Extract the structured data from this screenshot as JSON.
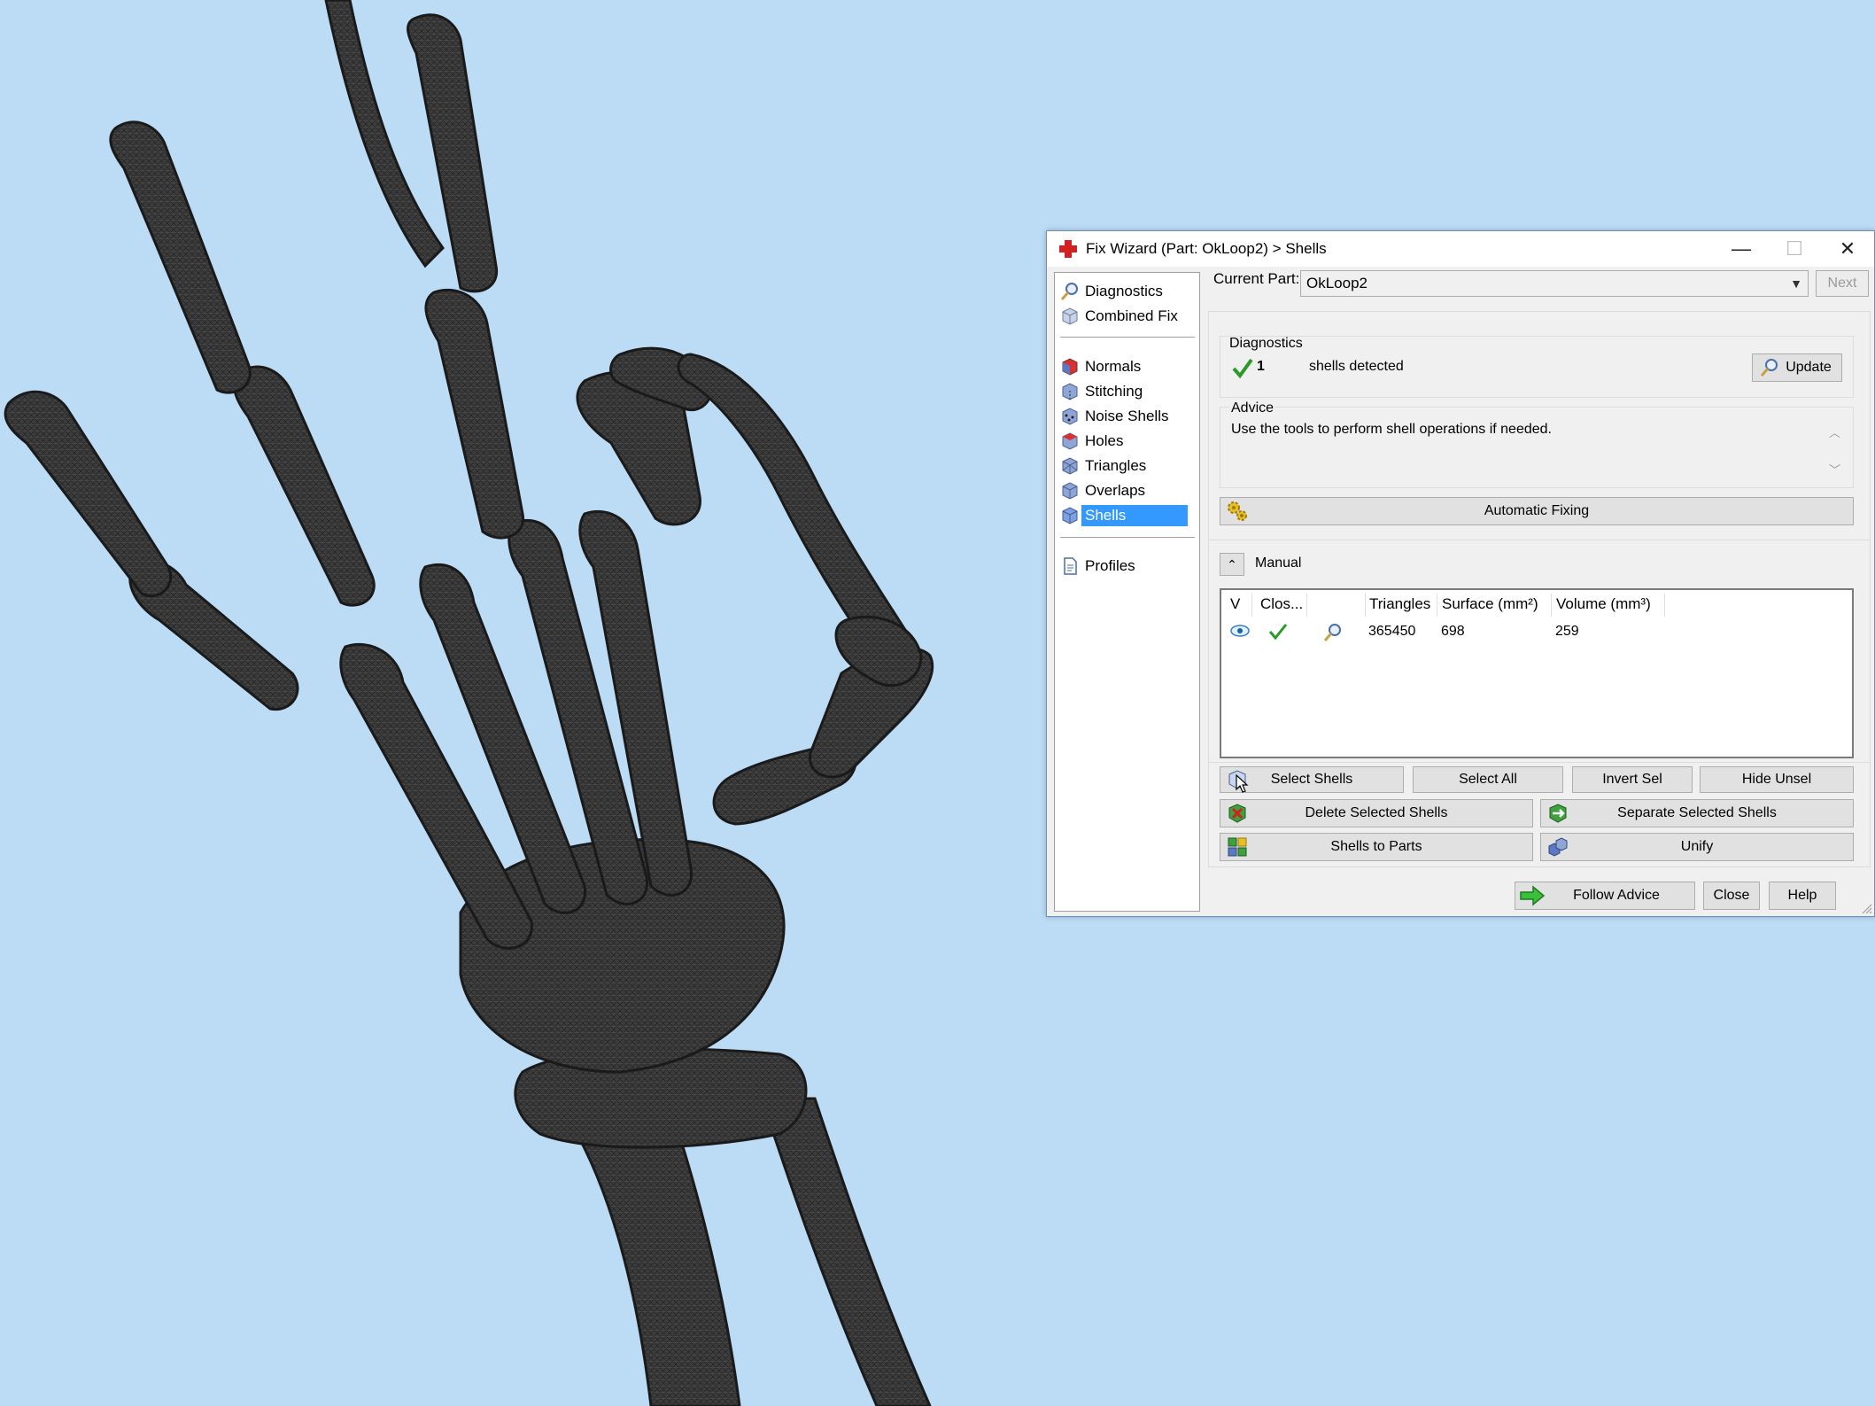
{
  "window": {
    "title": "Fix Wizard (Part: OkLoop2) > Shells",
    "minimize_glyph": "—",
    "maximize_glyph": "☐",
    "close_glyph": "✕"
  },
  "nav": {
    "items": [
      {
        "label": "Diagnostics",
        "icon": "magnifier-icon"
      },
      {
        "label": "Combined Fix",
        "icon": "cube-icon"
      },
      {
        "label": "Normals",
        "icon": "cube-red-icon"
      },
      {
        "label": "Stitching",
        "icon": "stitch-cube-icon"
      },
      {
        "label": "Noise Shells",
        "icon": "noise-cube-icon"
      },
      {
        "label": "Holes",
        "icon": "hole-cube-icon"
      },
      {
        "label": "Triangles",
        "icon": "triangle-cube-icon"
      },
      {
        "label": "Overlaps",
        "icon": "overlap-cube-icon"
      },
      {
        "label": "Shells",
        "icon": "shell-cube-icon",
        "selected": true
      },
      {
        "label": "Profiles",
        "icon": "document-icon"
      }
    ]
  },
  "current_part": {
    "label": "Current Part:",
    "value": "OkLoop2",
    "next_label": "Next"
  },
  "diagnostics": {
    "group_label": "Diagnostics",
    "count": "1",
    "status_text": "shells detected",
    "update_label": "Update"
  },
  "advice": {
    "group_label": "Advice",
    "text": "Use the tools to perform shell operations if needed."
  },
  "automatic_fixing_label": "Automatic Fixing",
  "manual": {
    "label": "Manual",
    "columns": [
      "V",
      "Clos...",
      "",
      "Triangles",
      "Surface (mm²)",
      "Volume (mm³)"
    ],
    "rows": [
      {
        "triangles": "365450",
        "surface": "698",
        "volume": "259"
      }
    ]
  },
  "buttons": {
    "select_shells": "Select Shells",
    "select_all": "Select All",
    "invert_sel": "Invert Sel",
    "hide_unsel": "Hide Unsel",
    "delete_selected": "Delete Selected Shells",
    "separate_selected": "Separate Selected Shells",
    "shells_to_parts": "Shells to Parts",
    "unify": "Unify",
    "follow_advice": "Follow Advice",
    "close": "Close",
    "help": "Help"
  },
  "colors": {
    "background": "#bcdcf6",
    "selection": "#3399ff",
    "bone": "#3a3a3a"
  }
}
